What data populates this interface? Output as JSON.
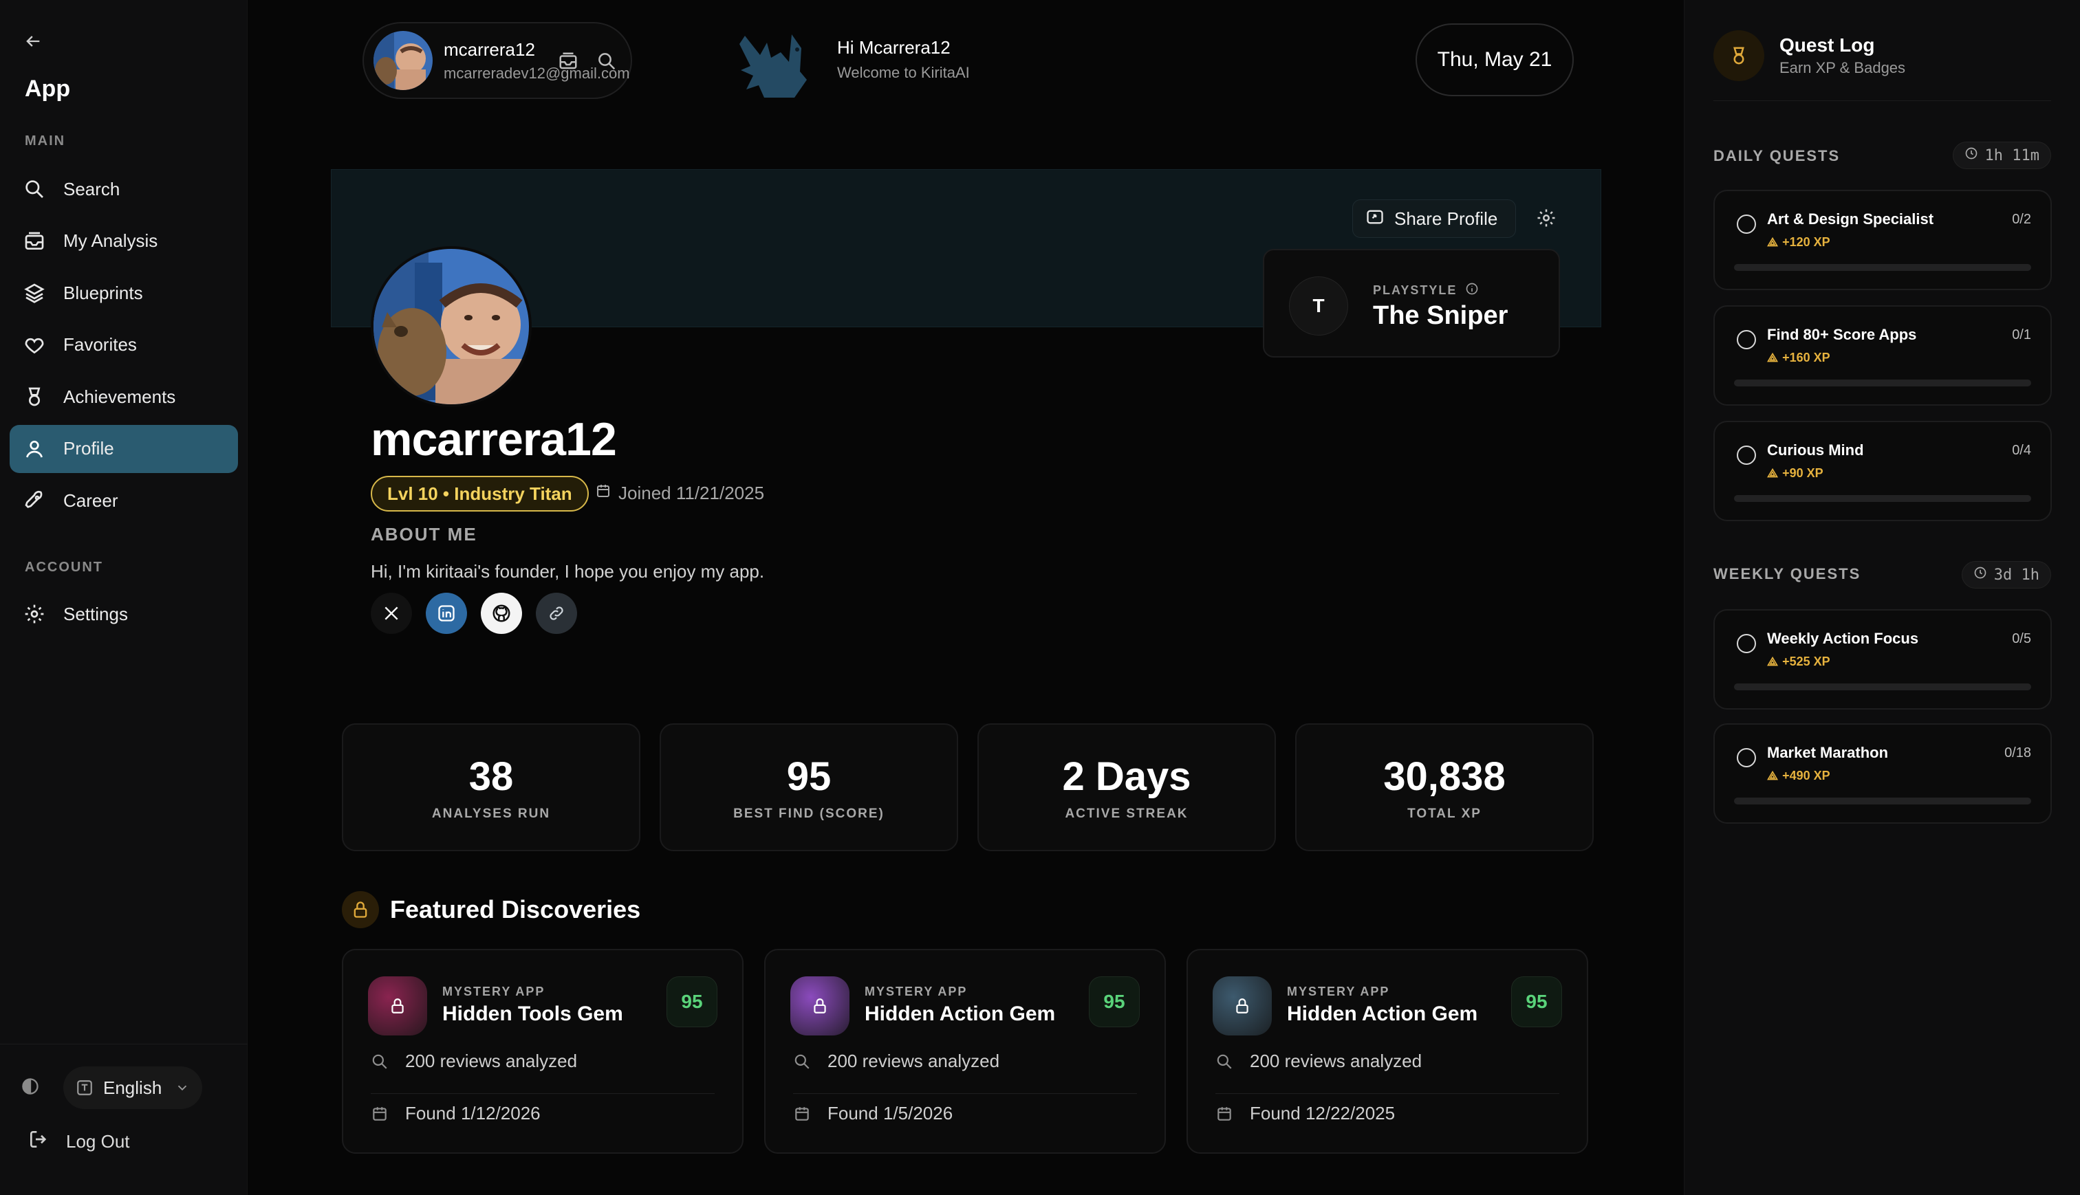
{
  "sidebar": {
    "app_title": "App",
    "main_label": "MAIN",
    "account_label": "ACCOUNT",
    "items": [
      {
        "label": "Search"
      },
      {
        "label": "My Analysis"
      },
      {
        "label": "Blueprints"
      },
      {
        "label": "Favorites"
      },
      {
        "label": "Achievements"
      },
      {
        "label": "Profile"
      },
      {
        "label": "Career"
      }
    ],
    "settings_label": "Settings",
    "language": "English",
    "logout_label": "Log Out"
  },
  "topbar": {
    "username": "mcarrera12",
    "email": "mcarreradev12@gmail.com",
    "greeting": "Hi Mcarrera12",
    "welcome": "Welcome to KiritaAI",
    "date": "Thu, May 21"
  },
  "profile": {
    "share_label": "Share Profile",
    "playstyle_initial": "T",
    "playstyle_label": "PLAYSTYLE",
    "playstyle_value": "The Sniper",
    "name": "mcarrera12",
    "level": "Lvl 10 • Industry Titan",
    "joined": "Joined 11/21/2025",
    "about_label": "ABOUT ME",
    "about_text": "Hi, I'm kiritaai's founder, I hope you enjoy my app."
  },
  "stats": [
    {
      "value": "38",
      "label": "ANALYSES RUN"
    },
    {
      "value": "95",
      "label": "BEST FIND (SCORE)"
    },
    {
      "value": "2 Days",
      "label": "ACTIVE STREAK"
    },
    {
      "value": "30,838",
      "label": "TOTAL XP"
    }
  ],
  "featured": {
    "title": "Featured Discoveries",
    "cards": [
      {
        "kicker": "MYSTERY APP",
        "name": "Hidden Tools Gem",
        "score": "95",
        "reviews": "200 reviews analyzed",
        "found": "Found 1/12/2026",
        "color": "#8a2450"
      },
      {
        "kicker": "MYSTERY APP",
        "name": "Hidden Action Gem",
        "score": "95",
        "reviews": "200 reviews analyzed",
        "found": "Found 1/5/2026",
        "color": "#8b4bbd"
      },
      {
        "kicker": "MYSTERY APP",
        "name": "Hidden Action Gem",
        "score": "95",
        "reviews": "200 reviews analyzed",
        "found": "Found 12/22/2025",
        "color": "#3d5a6e"
      }
    ]
  },
  "quest_log": {
    "title": "Quest Log",
    "subtitle": "Earn XP & Badges",
    "daily_label": "DAILY QUESTS",
    "daily_timer": "1h 11m",
    "weekly_label": "WEEKLY QUESTS",
    "weekly_timer": "3d 1h",
    "daily": [
      {
        "name": "Art & Design Specialist",
        "progress": "0/2",
        "xp": "+120 XP",
        "fraction": 0
      },
      {
        "name": "Find 80+ Score Apps",
        "progress": "0/1",
        "xp": "+160 XP",
        "fraction": 0
      },
      {
        "name": "Curious Mind",
        "progress": "0/4",
        "xp": "+90 XP",
        "fraction": 0
      }
    ],
    "weekly": [
      {
        "name": "Weekly Action Focus",
        "progress": "0/5",
        "xp": "+525 XP",
        "fraction": 0
      },
      {
        "name": "Market Marathon",
        "progress": "0/18",
        "xp": "+490 XP",
        "fraction": 0
      }
    ]
  },
  "colors": {
    "accent": "#2a5b70",
    "gold": "#e6b23e",
    "score_green": "#5ad37a"
  }
}
